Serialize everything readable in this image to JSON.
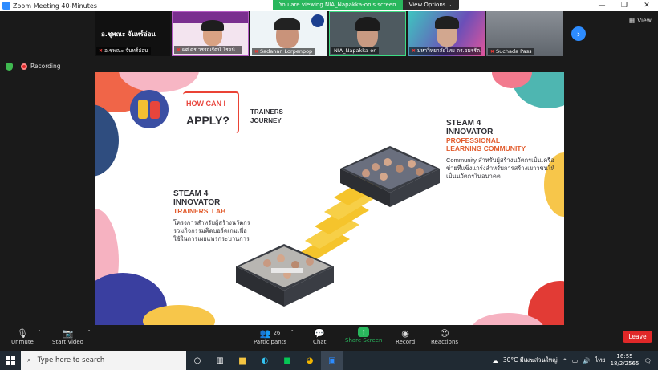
{
  "window": {
    "title": "Zoom Meeting 40-Minutes"
  },
  "banner": {
    "viewing": "You are viewing NIA_Napakka-on's screen",
    "view_options": "View Options ⌄"
  },
  "participants_strip": {
    "host_big_name": "อ.ชุพณะ จันทร์อ่อน",
    "tiles": [
      {
        "name": "อ.ชุพณะ จันทร์อ่อน"
      },
      {
        "name": "ผศ.ดร.วรรณรัตน์ โรจน์..."
      },
      {
        "name": "Sadanan Lorpenpop"
      },
      {
        "name": "NIA_Napakka-on"
      },
      {
        "name": "มหาวิทยาลัยไทย ดร.อมรรัต..."
      },
      {
        "name": "Suchada Pass"
      }
    ]
  },
  "view_button": "View",
  "recording_label": "Recording",
  "slide": {
    "how_can_i": "HOW CAN I",
    "apply": "APPLY?",
    "trainers_journey": "TRAINERS JOURNEY",
    "right": {
      "title1": "STEAM 4",
      "title2": "INNOVATOR",
      "sub1": "PROFESSIONAL",
      "sub2": "LEARNING COMMUNITY",
      "desc": "Community สำหรับผู้สร้างนวัตกรเป็นเครือข่ายที่แข็งแกร่งสำหรับการสร้างเยาวชนให้เป็นนวัตกรในอนาคต"
    },
    "left": {
      "title1": "STEAM 4",
      "title2": "INNOVATOR",
      "sub1": "TRAINERS' LAB",
      "desc": "โครงการสำหรับผู้สร้างนวัตกร รวมกิจกรรมคิดบอร์ดเกมเพื่อใช้ในการเผยแพร่กระบวนการ"
    }
  },
  "toolbar": {
    "unmute": "Unmute",
    "start_video": "Start Video",
    "participants": "Participants",
    "participants_count": "26",
    "chat": "Chat",
    "share_screen": "Share Screen",
    "record": "Record",
    "reactions": "Reactions",
    "leave": "Leave"
  },
  "taskbar": {
    "search_placeholder": "Type here to search",
    "weather": "30°C  มีเมฆส่วนใหญ่",
    "lang": "ไทย",
    "time": "16:55",
    "date": "18/2/2565"
  },
  "colors": {
    "zoom_blue": "#2d8cff",
    "share_green": "#29b75d",
    "leave_red": "#e02828",
    "accent_orange": "#e25c2d"
  }
}
